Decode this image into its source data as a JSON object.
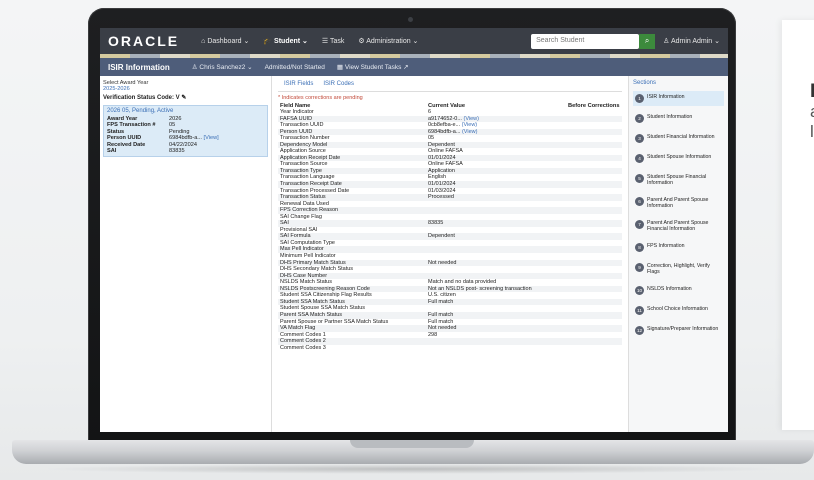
{
  "side_card": {
    "line1": "I",
    "line2": "a",
    "line3": "l"
  },
  "topbar": {
    "logo": "ORACLE",
    "nav": [
      "Dashboard ⌄",
      "Student ⌄",
      "Task",
      "Administration ⌄"
    ],
    "nav_icons": [
      "dashboard-icon",
      "student-icon",
      "task-icon",
      "gear-icon"
    ],
    "search_placeholder": "Search Student",
    "user": "Admin Admin ⌄"
  },
  "subbar": {
    "title": "ISIR Information",
    "student": "Chris Sanchez2 ⌄",
    "status": "Admitted/Not Started",
    "tasks": "View Student Tasks"
  },
  "left": {
    "select_label": "Select Award Year",
    "year": "2025-2026",
    "verification": "Verification Status Code: V",
    "card_head": "2026  05, Pending, Active",
    "rows": [
      {
        "k": "Award Year",
        "v": "2026"
      },
      {
        "k": "FPS Transaction #",
        "v": "05"
      },
      {
        "k": "Status",
        "v": "Pending"
      },
      {
        "k": "Person UUID",
        "v": "6984bdfb-a...",
        "link": "[View]"
      },
      {
        "k": "Received Date",
        "v": "04/22/2024"
      },
      {
        "k": "SAI",
        "v": "83835"
      }
    ]
  },
  "middle": {
    "tabs": [
      "ISIR Fields",
      "ISIR Codes"
    ],
    "note": "* Indicates corrections are pending",
    "headers": [
      "Field Name",
      "Current Value",
      "Before Corrections"
    ],
    "rows": [
      [
        "Year Indicator",
        "6",
        ""
      ],
      [
        "FAFSA UUID",
        "a9174652-0...",
        "(View)"
      ],
      [
        "Transaction UUID",
        "0cb8efba-e...",
        "(View)"
      ],
      [
        "Person UUID",
        "6984bdfb-a...",
        "(View)"
      ],
      [
        "Transaction Number",
        "05",
        ""
      ],
      [
        "Dependency Model",
        "Dependent",
        ""
      ],
      [
        "Application Source",
        "Online FAFSA",
        ""
      ],
      [
        "Application Receipt Date",
        "01/01/2024",
        ""
      ],
      [
        "Transaction Source",
        "Online FAFSA",
        ""
      ],
      [
        "Transaction Type",
        "Application",
        ""
      ],
      [
        "Transaction Language",
        "English",
        ""
      ],
      [
        "Transaction Receipt Date",
        "01/01/2024",
        ""
      ],
      [
        "Transaction Processed Date",
        "01/03/2024",
        ""
      ],
      [
        "Transaction Status",
        "Processed",
        ""
      ],
      [
        "Renewal Data Used",
        "",
        ""
      ],
      [
        "FPS Correction Reason",
        "",
        ""
      ],
      [
        "SAI Change Flag",
        "",
        ""
      ],
      [
        "SAI",
        "83835",
        ""
      ],
      [
        "Provisional SAI",
        "",
        ""
      ],
      [
        "SAI Formula",
        "Dependent",
        ""
      ],
      [
        "SAI Computation Type",
        "",
        ""
      ],
      [
        "Max Pell Indicator",
        "",
        ""
      ],
      [
        "Minimum Pell Indicator",
        "",
        ""
      ],
      [
        "DHS Primary Match Status",
        "Not needed",
        ""
      ],
      [
        "DHS Secondary Match Status",
        "",
        ""
      ],
      [
        "DHS Case Number",
        "",
        ""
      ],
      [
        "NSLDS Match Status",
        "Match and no data provided",
        ""
      ],
      [
        "NSLDS Postscreening Reason Code",
        "Not an NSLDS post- screening transaction",
        ""
      ],
      [
        "Student SSA Citizenship Flag Results",
        "U.S. citizen",
        ""
      ],
      [
        "Student SSA Match Status",
        "Full match",
        ""
      ],
      [
        "Student Spouse SSA Match Status",
        "",
        ""
      ],
      [
        "Parent SSA Match Status",
        "Full match",
        ""
      ],
      [
        "Parent Spouse or Partner SSA Match Status",
        "Full match",
        ""
      ],
      [
        "VA Match Flag",
        "Not needed",
        ""
      ],
      [
        "Comment Codes 1",
        "298",
        ""
      ],
      [
        "Comment Codes 2",
        "",
        ""
      ],
      [
        "Comment Codes 3",
        "",
        ""
      ]
    ]
  },
  "sections": {
    "title": "Sections",
    "items": [
      {
        "n": "1",
        "label": "ISIR Information"
      },
      {
        "n": "2",
        "label": "Student Information"
      },
      {
        "n": "3",
        "label": "Student Financial Information"
      },
      {
        "n": "4",
        "label": "Student Spouse Information"
      },
      {
        "n": "5",
        "label": "Student Spouse Financial Information"
      },
      {
        "n": "6",
        "label": "Parent And Parent Spouse Information"
      },
      {
        "n": "7",
        "label": "Parent And Parent Spouse Financial Information"
      },
      {
        "n": "8",
        "label": "FPS Information"
      },
      {
        "n": "9",
        "label": "Correction, Highlight, Verify Flags"
      },
      {
        "n": "10",
        "label": "NSLDS Information"
      },
      {
        "n": "11",
        "label": "School Choice Information"
      },
      {
        "n": "12",
        "label": "Signature/Preparer Information"
      }
    ]
  }
}
